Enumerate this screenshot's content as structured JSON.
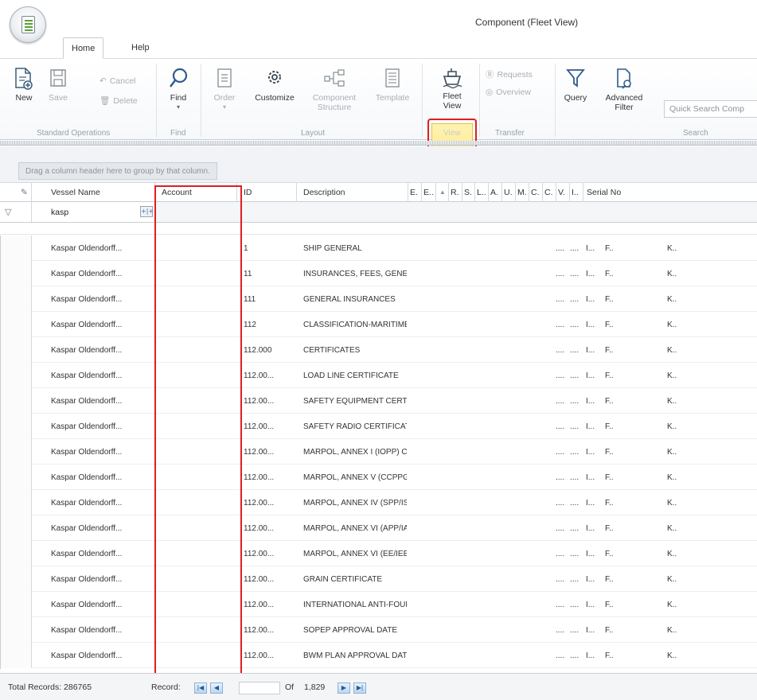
{
  "window": {
    "title": "Component (Fleet View)"
  },
  "tabs": [
    {
      "label": "Home",
      "active": true
    },
    {
      "label": "Help",
      "active": false
    }
  ],
  "ribbon": {
    "standard_operations": {
      "label": "Standard Operations",
      "new": "New",
      "save": "Save",
      "cancel": "Cancel",
      "delete": "Delete"
    },
    "find_group": {
      "label": "Find",
      "find": "Find"
    },
    "layout_group": {
      "label": "Layout",
      "order": "Order",
      "customize": "Customize",
      "component_structure_1": "Component",
      "component_structure_2": "Structure",
      "template": "Template"
    },
    "view_group": {
      "label": "View",
      "fleet_view_1": "Fleet",
      "fleet_view_2": "View"
    },
    "transfer_group": {
      "label": "Transfer",
      "requests": "Requests",
      "overview": "Overview"
    },
    "search_group": {
      "label": "Search",
      "query": "Query",
      "advanced_filter_1": "Advanced",
      "advanced_filter_2": "Filter",
      "quick_search_placeholder": "Quick Search Comp"
    }
  },
  "group_panel": {
    "hint": "Drag a column header here to group by that column."
  },
  "columns": {
    "vessel_name": "Vessel Name",
    "account": "Account",
    "id": "ID",
    "description": "Description",
    "e1": "E.",
    "e2": "E..",
    "r": "R.",
    "s": "S.",
    "l": "L..",
    "a": "A.",
    "u": "U.",
    "m": "M.",
    "c1": "C.",
    "c2": "C.",
    "v": "V.",
    "i": "I..",
    "serial_no": "Serial No"
  },
  "filter": {
    "vessel_name": "kasp"
  },
  "rows": [
    {
      "vessel": "Kaspar Oldendorff...",
      "account": "",
      "id": "1",
      "description": "SHIP GENERAL",
      "l": "....",
      "a": "....",
      "u": "I...",
      "m": "F..",
      "v": "K.."
    },
    {
      "vessel": "Kaspar Oldendorff...",
      "account": "",
      "id": "11",
      "description": "INSURANCES, FEES, GENER...",
      "l": "....",
      "a": "....",
      "u": "I...",
      "m": "F..",
      "v": "K.."
    },
    {
      "vessel": "Kaspar Oldendorff...",
      "account": "",
      "id": "111",
      "description": "GENERAL INSURANCES",
      "l": "....",
      "a": "....",
      "u": "I...",
      "m": "F..",
      "v": "K.."
    },
    {
      "vessel": "Kaspar Oldendorff...",
      "account": "",
      "id": "112",
      "description": "CLASSIFICATION-MARITIME...",
      "l": "....",
      "a": "....",
      "u": "I...",
      "m": "F..",
      "v": "K.."
    },
    {
      "vessel": "Kaspar Oldendorff...",
      "account": "",
      "id": "112.000",
      "description": "CERTIFICATES",
      "l": "....",
      "a": "....",
      "u": "I...",
      "m": "F..",
      "v": "K.."
    },
    {
      "vessel": "Kaspar Oldendorff...",
      "account": "",
      "id": "112.00...",
      "description": "LOAD LINE CERTIFICATE",
      "l": "....",
      "a": "....",
      "u": "I...",
      "m": "F..",
      "v": "K.."
    },
    {
      "vessel": "Kaspar Oldendorff...",
      "account": "",
      "id": "112.00...",
      "description": "SAFETY EQUIPMENT CERTIF...",
      "l": "....",
      "a": "....",
      "u": "I...",
      "m": "F..",
      "v": "K.."
    },
    {
      "vessel": "Kaspar Oldendorff...",
      "account": "",
      "id": "112.00...",
      "description": "SAFETY RADIO CERTIFICATE",
      "l": "....",
      "a": "....",
      "u": "I...",
      "m": "F..",
      "v": "K.."
    },
    {
      "vessel": "Kaspar Oldendorff...",
      "account": "",
      "id": "112.00...",
      "description": "MARPOL, ANNEX I (IOPP) CE...",
      "l": "....",
      "a": "....",
      "u": "I...",
      "m": "F..",
      "v": "K.."
    },
    {
      "vessel": "Kaspar Oldendorff...",
      "account": "",
      "id": "112.00...",
      "description": "MARPOL, ANNEX V (CCPPG) ...",
      "l": "....",
      "a": "....",
      "u": "I...",
      "m": "F..",
      "v": "K.."
    },
    {
      "vessel": "Kaspar Oldendorff...",
      "account": "",
      "id": "112.00...",
      "description": "MARPOL, ANNEX IV (SPP/ISP...",
      "l": "....",
      "a": "....",
      "u": "I...",
      "m": "F..",
      "v": "K.."
    },
    {
      "vessel": "Kaspar Oldendorff...",
      "account": "",
      "id": "112.00...",
      "description": "MARPOL, ANNEX VI (APP/IA...",
      "l": "....",
      "a": "....",
      "u": "I...",
      "m": "F..",
      "v": "K.."
    },
    {
      "vessel": "Kaspar Oldendorff...",
      "account": "",
      "id": "112.00...",
      "description": "MARPOL, ANNEX VI (EE/IEE) ...",
      "l": "....",
      "a": "....",
      "u": "I...",
      "m": "F..",
      "v": "K.."
    },
    {
      "vessel": "Kaspar Oldendorff...",
      "account": "",
      "id": "112.00...",
      "description": "GRAIN CERTIFICATE",
      "l": "....",
      "a": "....",
      "u": "I...",
      "m": "F..",
      "v": "K.."
    },
    {
      "vessel": "Kaspar Oldendorff...",
      "account": "",
      "id": "112.00...",
      "description": "INTERNATIONAL ANTI-FOUL...",
      "l": "....",
      "a": "....",
      "u": "I...",
      "m": "F..",
      "v": "K.."
    },
    {
      "vessel": "Kaspar Oldendorff...",
      "account": "",
      "id": "112.00...",
      "description": "SOPEP APPROVAL DATE",
      "l": "....",
      "a": "....",
      "u": "I...",
      "m": "F..",
      "v": "K.."
    },
    {
      "vessel": "Kaspar Oldendorff...",
      "account": "",
      "id": "112.00...",
      "description": "BWM PLAN APPROVAL DATE",
      "l": "....",
      "a": "....",
      "u": "I...",
      "m": "F..",
      "v": "K.."
    }
  ],
  "footer": {
    "total_records": "Total Records: 286765",
    "record_label": "Record:",
    "of_label": "Of",
    "page_count": "1,829"
  },
  "colors": {
    "highlight": "#e01e1e",
    "fleet_view_active": "#fde27a",
    "nav_blue": "#1e5aa6"
  }
}
